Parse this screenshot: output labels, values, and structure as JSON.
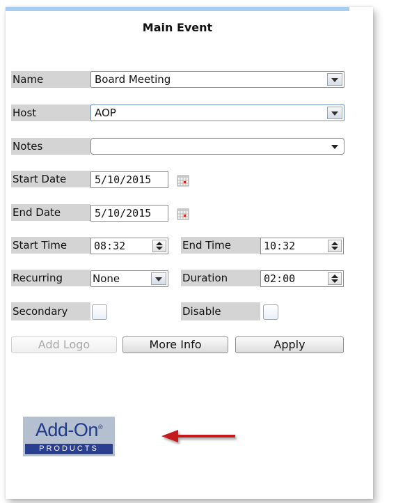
{
  "dialog": {
    "title": "Main Event"
  },
  "fields": {
    "name": {
      "label": "Name",
      "value": "Board Meeting"
    },
    "host": {
      "label": "Host",
      "value": "AOP"
    },
    "notes": {
      "label": "Notes",
      "value": ""
    },
    "start_date": {
      "label": "Start Date",
      "value": "5/10/2015"
    },
    "end_date": {
      "label": "End Date",
      "value": "5/10/2015"
    },
    "start_time": {
      "label": "Start Time",
      "value": "08:32"
    },
    "end_time": {
      "label": "End Time",
      "value": "10:32"
    },
    "recurring": {
      "label": "Recurring",
      "value": "None"
    },
    "duration": {
      "label": "Duration",
      "value": "02:00"
    },
    "secondary": {
      "label": "Secondary",
      "checked": false
    },
    "disable": {
      "label": "Disable",
      "checked": false
    }
  },
  "buttons": {
    "add_logo": "Add Logo",
    "more_info": "More Info",
    "apply": "Apply"
  },
  "logo": {
    "line1": "Add-On",
    "line2": "PRODUCTS",
    "registered": "®"
  },
  "icons": {
    "calendar": "calendar-icon",
    "dropdown": "chevron-down-icon",
    "spinner": "spinner-icon",
    "annotation": "red-arrow-icon"
  },
  "colors": {
    "accent_bar": "#a9cdf0",
    "label_bg": "#d4d4d4",
    "logo_blue": "#2a3f8f",
    "arrow_red": "#c41a1a"
  }
}
